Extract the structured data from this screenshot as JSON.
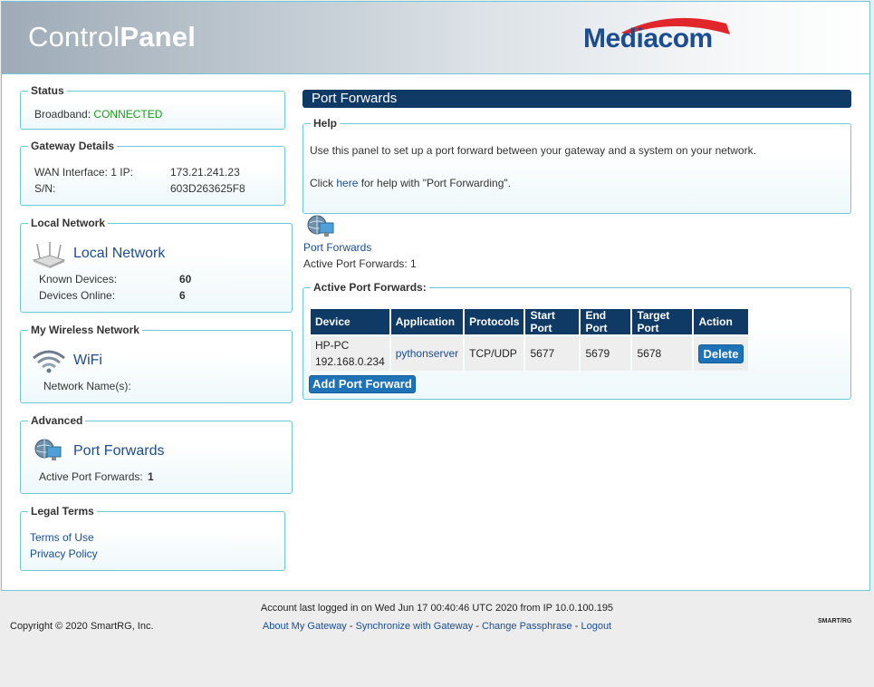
{
  "header": {
    "title_light": "Control",
    "title_bold": "Panel",
    "brand": "Mediacom"
  },
  "sidebar": {
    "status": {
      "legend": "Status",
      "label": "Broadband:",
      "value": "CONNECTED"
    },
    "gateway": {
      "legend": "Gateway Details",
      "wan_label": "WAN Interface: 1 IP:",
      "wan_value": "173.21.241.23",
      "sn_label": "S/N:",
      "sn_value": "603D263625F8"
    },
    "local_network": {
      "legend": "Local Network",
      "title": "Local Network",
      "known_label": "Known Devices:",
      "known_value": "60",
      "online_label": "Devices Online:",
      "online_value": "6"
    },
    "wireless": {
      "legend": "My Wireless Network",
      "title": "WiFi",
      "names_label": "Network Name(s):"
    },
    "advanced": {
      "legend": "Advanced",
      "title": "Port Forwards",
      "active_label": "Active Port Forwards:",
      "active_value": "1"
    },
    "legal": {
      "legend": "Legal Terms",
      "terms": "Terms of Use",
      "privacy": "Privacy Policy"
    }
  },
  "main": {
    "title": "Port Forwards",
    "help": {
      "legend": "Help",
      "line1": "Use this panel to set up a port forward between your gateway and a system on your network.",
      "line2_pre": "Click ",
      "line2_link": "here",
      "line2_post": " for help with \"Port Forwarding\"."
    },
    "icon_label": "Port Forwards",
    "active_count_label": "Active Port Forwards: 1",
    "table": {
      "legend": "Active Port Forwards:",
      "headers": [
        "Device",
        "Application",
        "Protocols",
        "Start Port",
        "End Port",
        "Target Port",
        "Action"
      ],
      "rows": [
        {
          "device_name": "HP-PC",
          "device_ip": "192.168.0.234",
          "application": "pythonserver",
          "protocols": "TCP/UDP",
          "start_port": "5677",
          "end_port": "5679",
          "target_port": "5678",
          "action": "Delete"
        }
      ]
    },
    "add_button": "Add Port Forward"
  },
  "footer": {
    "login_info": "Account last logged in on Wed Jun 17 00:40:46 UTC 2020 from IP 10.0.100.195",
    "links": [
      "About My Gateway",
      "Synchronize with Gateway",
      "Change Passphrase",
      "Logout"
    ],
    "separator": " - ",
    "copyright": "Copyright © 2020 SmartRG, Inc.",
    "vendor_logo": "SMART/RG"
  },
  "colors": {
    "accent_border": "#6fc7d8",
    "title_bar": "#0f3a66",
    "link": "#1b4d8f",
    "connected": "#1a9a1a",
    "button": "#1e73b8"
  }
}
